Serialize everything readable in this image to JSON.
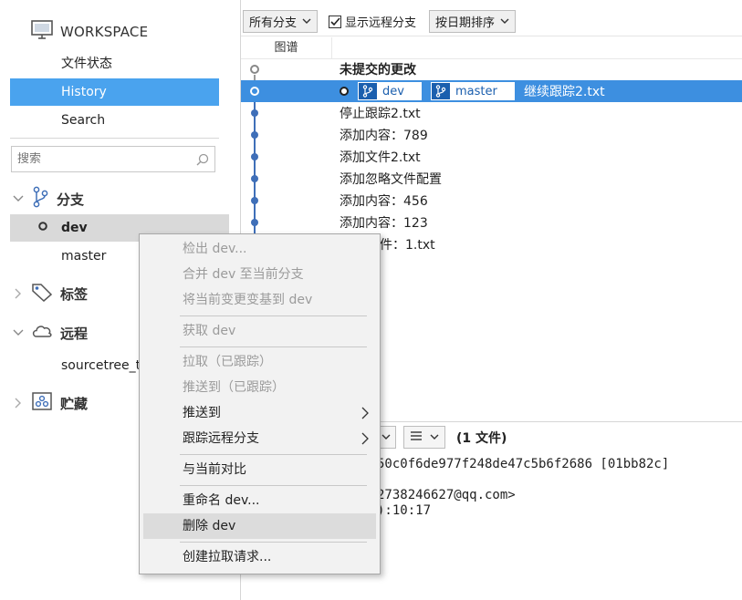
{
  "sidebar": {
    "workspace_title": "WORKSPACE",
    "nav": [
      "文件状态",
      "History",
      "Search"
    ],
    "search_placeholder": "搜索",
    "sections": {
      "branches": "分支",
      "tags": "标签",
      "remotes": "远程",
      "stashes": "贮藏"
    },
    "branches": [
      "dev",
      "master"
    ],
    "remote_name": "sourcetree_t"
  },
  "toolbar": {
    "branch_filter": "所有分支",
    "show_remote_label": "显示远程分支",
    "show_remote_checked": true,
    "sort": "按日期排序"
  },
  "graph": {
    "column_header": "图谱",
    "rows": [
      {
        "message": "未提交的更改"
      },
      {
        "message": "继续跟踪2.txt",
        "tags": [
          "dev",
          "master"
        ]
      },
      {
        "message": "停止跟踪2.txt"
      },
      {
        "message": "添加内容：789"
      },
      {
        "message": "添加文件2.txt"
      },
      {
        "message": "添加忽略文件配置"
      },
      {
        "message": "添加内容：456"
      },
      {
        "message": "添加内容：123"
      },
      {
        "message": "件：1.txt"
      }
    ]
  },
  "details": {
    "files_count": "(1 文件)",
    "hash_line": "50c0f6de977f248de47c5b6f2686 [01bb82c]",
    "author_line": "2738246627@qq.com>",
    "date_line": "):10:17"
  },
  "context_menu": {
    "items": [
      {
        "label": "检出 dev...",
        "disabled": true
      },
      {
        "label": "合并 dev 至当前分支",
        "disabled": true
      },
      {
        "label": "将当前变更变基到 dev",
        "disabled": true
      },
      {
        "label": "获取 dev",
        "disabled": true
      },
      {
        "label": "拉取（已跟踪）",
        "disabled": true
      },
      {
        "label": "推送到（已跟踪）",
        "disabled": true
      },
      {
        "label": "推送到",
        "disabled": false,
        "submenu": true
      },
      {
        "label": "跟踪远程分支",
        "disabled": false,
        "submenu": true
      },
      {
        "label": "与当前对比",
        "disabled": false
      },
      {
        "label": "重命名 dev...",
        "disabled": false
      },
      {
        "label": "删除 dev",
        "disabled": false,
        "highlighted": true
      },
      {
        "label": "创建拉取请求...",
        "disabled": false
      }
    ]
  },
  "colors": {
    "accent": "#4aa3ee",
    "selected_row": "#3d8fe0",
    "graph_line": "#3f6fb8",
    "tag_blue": "#1b5fae"
  }
}
